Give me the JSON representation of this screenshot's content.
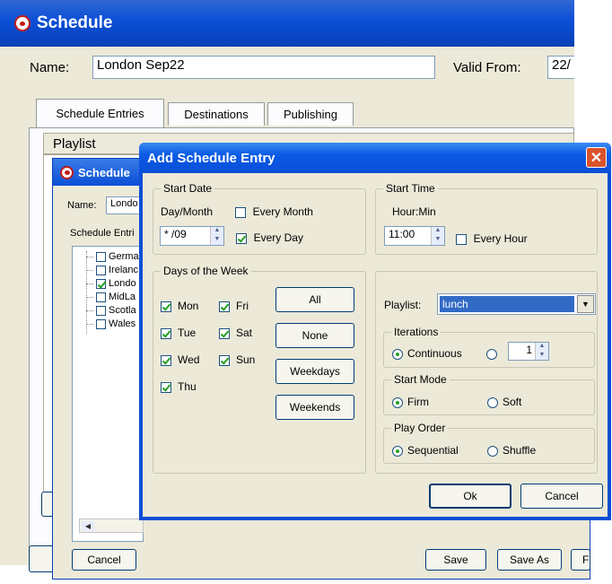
{
  "app": {
    "title": "Schedule"
  },
  "main": {
    "name_label": "Name:",
    "name_value": "London Sep22",
    "valid_from_label": "Valid From:",
    "valid_from_value": "22/",
    "tabs": [
      "Schedule Entries",
      "Destinations",
      "Publishing"
    ],
    "column_header": "Playlist"
  },
  "second": {
    "title": "Schedule",
    "name_label": "Name:",
    "name_value": "Londo",
    "tab_label": "Schedule Entri",
    "tree": [
      {
        "label": "Germa",
        "checked": false
      },
      {
        "label": "Irelanc",
        "checked": false
      },
      {
        "label": "Londo",
        "checked": true
      },
      {
        "label": "MidLa",
        "checked": false
      },
      {
        "label": "Scotla",
        "checked": false
      },
      {
        "label": "Wales",
        "checked": false
      }
    ],
    "cancel": "Cancel",
    "save": "Save",
    "save_as": "Save As",
    "cut_button": "F"
  },
  "dialog": {
    "title": "Add Schedule Entry",
    "start_date": {
      "legend": "Start Date",
      "daymonth_label": "Day/Month",
      "every_month": "Every Month",
      "date_value": "* /09",
      "every_day": "Every Day"
    },
    "start_time": {
      "legend": "Start Time",
      "hourmin_label": "Hour:Min",
      "time_value": "11:00",
      "every_hour": "Every Hour"
    },
    "days": {
      "legend": "Days of the Week",
      "mon": "Mon",
      "tue": "Tue",
      "wed": "Wed",
      "thu": "Thu",
      "fri": "Fri",
      "sat": "Sat",
      "sun": "Sun",
      "all": "All",
      "none": "None",
      "weekdays": "Weekdays",
      "weekends": "Weekends"
    },
    "playlist_label": "Playlist:",
    "playlist_value": "lunch",
    "iterations": {
      "legend": "Iterations",
      "continuous": "Continuous",
      "count": "1"
    },
    "start_mode": {
      "legend": "Start Mode",
      "firm": "Firm",
      "soft": "Soft"
    },
    "play_order": {
      "legend": "Play Order",
      "sequential": "Sequential",
      "shuffle": "Shuffle"
    },
    "ok": "Ok",
    "cancel": "Cancel"
  },
  "colors": {
    "title_blue": "#0a4fd6",
    "title_blue_light": "#3b8cf2",
    "selection": "#316ac5",
    "close_red": "#d9532b"
  }
}
